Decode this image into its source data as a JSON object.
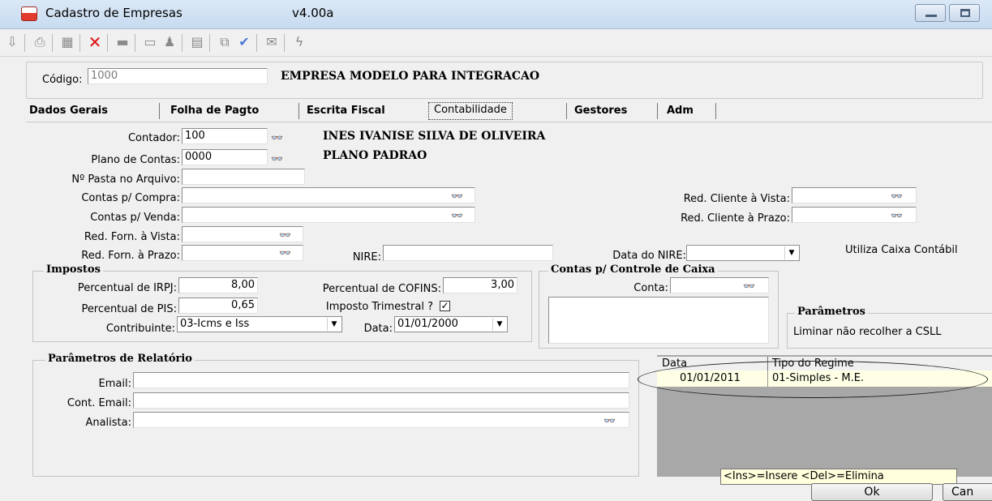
{
  "window": {
    "title": "Cadastro de Empresas",
    "version": "v4.00a"
  },
  "toolbar": {
    "icons": [
      "exit-icon",
      "print-icon",
      "calculator-icon",
      "delete-icon",
      "folder-icon",
      "report-icon",
      "search-person-icon",
      "document-icon",
      "copy-icon",
      "check-icon",
      "mail-icon",
      "lightning-icon"
    ]
  },
  "header": {
    "code_label": "Código:",
    "code_value": "1000",
    "company_name": "EMPRESA MODELO PARA INTEGRACAO"
  },
  "tabs": [
    {
      "label": "Dados Gerais"
    },
    {
      "label": "Folha de Pagto"
    },
    {
      "label": "Escrita Fiscal"
    },
    {
      "label": "Contabilidade"
    },
    {
      "label": "Gestores"
    },
    {
      "label": "Adm"
    }
  ],
  "form": {
    "contador_label": "Contador:",
    "contador_value": "100",
    "contador_name": "INES IVANISE SILVA DE OLIVEIRA",
    "plano_label": "Plano de Contas:",
    "plano_value": "0000",
    "plano_name": "PLANO PADRAO",
    "pasta_label": "Nº Pasta no Arquivo:",
    "compra_label": "Contas p/ Compra:",
    "venda_label": "Contas p/ Venda:",
    "forn_vista_label": "Red. Forn. à Vista:",
    "forn_prazo_label": "Red. Forn. à Prazo:",
    "nire_label": "NIRE:",
    "data_nire_label": "Data do NIRE:",
    "cliente_vista_label": "Red. Cliente à Vista:",
    "cliente_prazo_label": "Red. Cliente à Prazo:",
    "caixa_contabil_label": "Utiliza Caixa Contábil"
  },
  "impostos": {
    "title": "Impostos",
    "irpj_label": "Percentual de IRPJ:",
    "irpj_value": "8,00",
    "cofins_label": "Percentual de COFINS:",
    "cofins_value": "3,00",
    "pis_label": "Percentual de PIS:",
    "pis_value": "0,65",
    "trimestral_label": "Imposto Trimestral ?",
    "trimestral_checked": true,
    "contribuinte_label": "Contribuinte:",
    "contribuinte_value": "03-Icms e Iss",
    "data_label": "Data:",
    "data_value": "01/01/2000"
  },
  "caixa": {
    "title": "Contas p/ Controle de Caixa",
    "conta_label": "Conta:"
  },
  "parametros": {
    "title": "Parâmetros",
    "liminar_label": "Liminar não recolher a CSLL"
  },
  "relatorio": {
    "title": "Parâmetros de Relatório",
    "email_label": "Email:",
    "cont_email_label": "Cont. Email:",
    "analista_label": "Analista:"
  },
  "regime_grid": {
    "columns": [
      "Data",
      "Tipo do Regime"
    ],
    "rows": [
      [
        "01/01/2011",
        "01-Simples - M.E."
      ]
    ],
    "hint": "<Ins>=Insere <Del>=Elimina"
  },
  "buttons": {
    "ok": "Ok",
    "cancel": "Can"
  },
  "colors": {
    "titlebar": "#c7dbf0",
    "grid_bg": "#a8a8a8",
    "row_bg": "#ffffe6",
    "hint_bg": "#ffffdc"
  }
}
